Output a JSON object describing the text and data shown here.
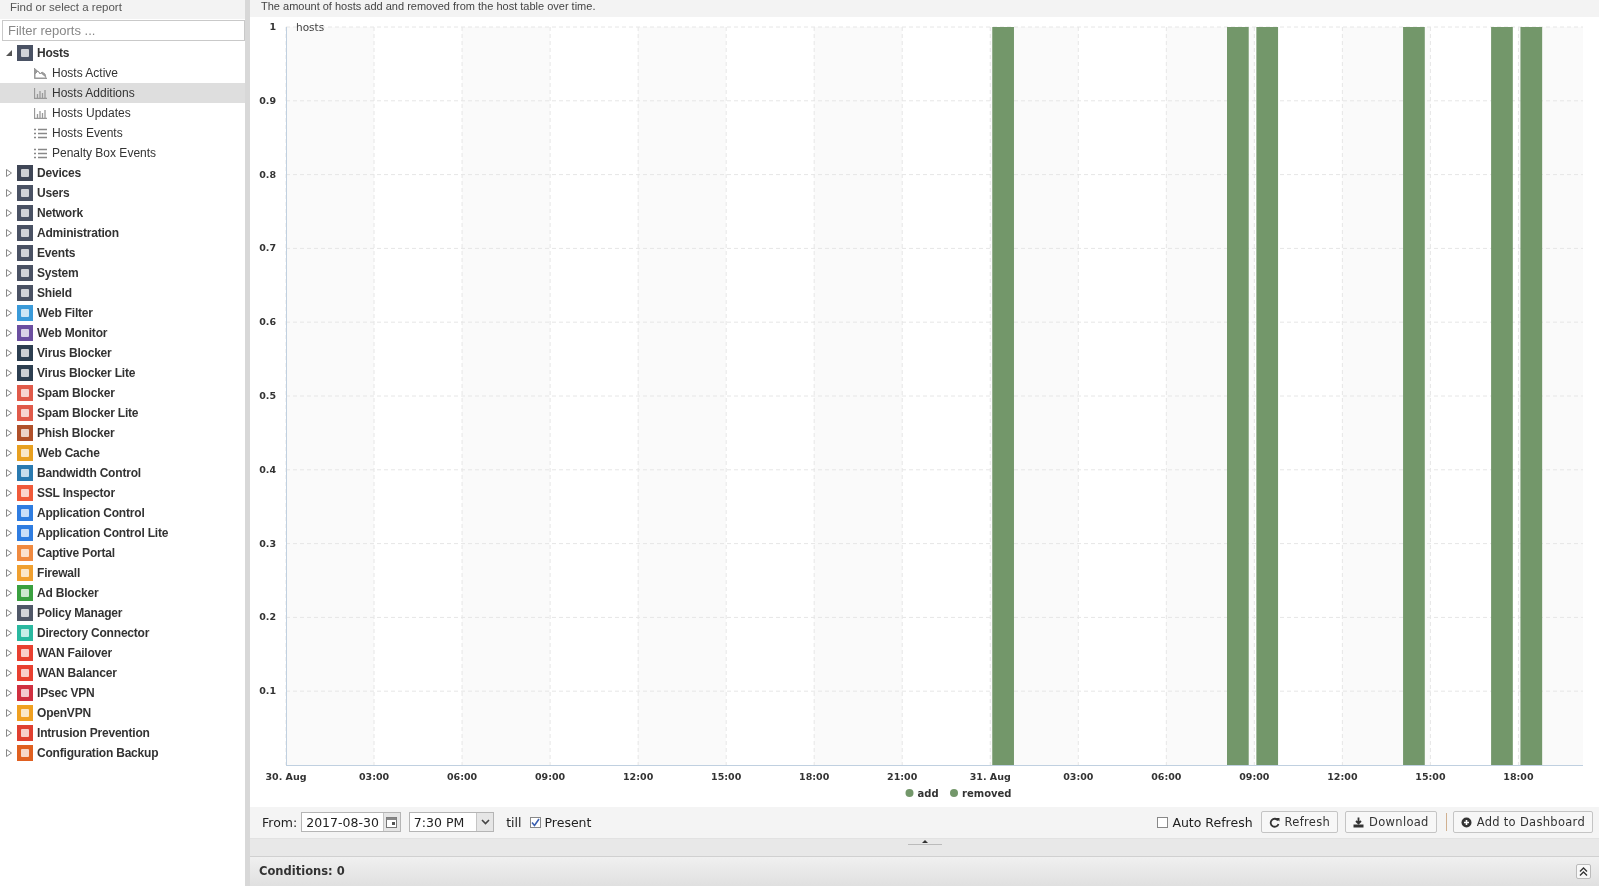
{
  "sidebar": {
    "header": "Find or select a report",
    "filter": {
      "placeholder": "Filter reports ..."
    },
    "items": [
      {
        "label": "Hosts",
        "color": "#4a5264",
        "expanded": true,
        "children": [
          {
            "label": "Hosts Active",
            "kind": "area",
            "selected": false
          },
          {
            "label": "Hosts Additions",
            "kind": "bar",
            "selected": true
          },
          {
            "label": "Hosts Updates",
            "kind": "bar",
            "selected": false
          },
          {
            "label": "Hosts Events",
            "kind": "list",
            "selected": false
          },
          {
            "label": "Penalty Box Events",
            "kind": "list",
            "selected": false
          }
        ]
      },
      {
        "label": "Devices",
        "color": "#3f4656",
        "expanded": false
      },
      {
        "label": "Users",
        "color": "#4a5264",
        "expanded": false
      },
      {
        "label": "Network",
        "color": "#4a5264",
        "expanded": false
      },
      {
        "label": "Administration",
        "color": "#4a5264",
        "expanded": false
      },
      {
        "label": "Events",
        "color": "#4a5264",
        "expanded": false
      },
      {
        "label": "System",
        "color": "#4a5264",
        "expanded": false
      },
      {
        "label": "Shield",
        "color": "#4a5264",
        "expanded": false
      },
      {
        "label": "Web Filter",
        "color": "#3a9ad9",
        "expanded": false
      },
      {
        "label": "Web Monitor",
        "color": "#6b4fa0",
        "expanded": false
      },
      {
        "label": "Virus Blocker",
        "color": "#2c3e50",
        "expanded": false
      },
      {
        "label": "Virus Blocker Lite",
        "color": "#2c3e50",
        "expanded": false
      },
      {
        "label": "Spam Blocker",
        "color": "#e05a4a",
        "expanded": false
      },
      {
        "label": "Spam Blocker Lite",
        "color": "#e05a4a",
        "expanded": false
      },
      {
        "label": "Phish Blocker",
        "color": "#b0502a",
        "expanded": false
      },
      {
        "label": "Web Cache",
        "color": "#e8a020",
        "expanded": false
      },
      {
        "label": "Bandwidth Control",
        "color": "#2a7ab0",
        "expanded": false
      },
      {
        "label": "SSL Inspector",
        "color": "#f05a3a",
        "expanded": false
      },
      {
        "label": "Application Control",
        "color": "#2f7de1",
        "expanded": false
      },
      {
        "label": "Application Control Lite",
        "color": "#2f7de1",
        "expanded": false
      },
      {
        "label": "Captive Portal",
        "color": "#f08a40",
        "expanded": false
      },
      {
        "label": "Firewall",
        "color": "#f0a030",
        "expanded": false
      },
      {
        "label": "Ad Blocker",
        "color": "#3aa040",
        "expanded": false
      },
      {
        "label": "Policy Manager",
        "color": "#505868",
        "expanded": false
      },
      {
        "label": "Directory Connector",
        "color": "#2ab8a0",
        "expanded": false
      },
      {
        "label": "WAN Failover",
        "color": "#e84030",
        "expanded": false
      },
      {
        "label": "WAN Balancer",
        "color": "#e84030",
        "expanded": false
      },
      {
        "label": "IPsec VPN",
        "color": "#d03040",
        "expanded": false
      },
      {
        "label": "OpenVPN",
        "color": "#f0a020",
        "expanded": false
      },
      {
        "label": "Intrusion Prevention",
        "color": "#e04030",
        "expanded": false
      },
      {
        "label": "Configuration Backup",
        "color": "#e06020",
        "expanded": false
      }
    ]
  },
  "report": {
    "description": "The amount of hosts add and removed from the host table over time.",
    "chart_data": {
      "type": "bar",
      "ylabel": "hosts",
      "x": [
        "2017-08-31T00:00",
        "2017-08-31T08:00",
        "2017-08-31T09:00",
        "2017-08-31T14:00",
        "2017-08-31T17:00",
        "2017-08-31T18:00"
      ],
      "series": [
        {
          "name": "add",
          "color": "#73976a",
          "values": [
            1,
            1,
            1,
            1,
            1,
            1
          ]
        },
        {
          "name": "removed",
          "color": "#73976a",
          "values": [
            0,
            0,
            0,
            0,
            0,
            0
          ]
        }
      ],
      "xlim": [
        "2017-08-30T00:00",
        "2017-08-31T20:12"
      ],
      "ylim": [
        0,
        1
      ],
      "grid": true,
      "yticks": [
        0.1,
        0.2,
        0.3,
        0.4,
        0.5,
        0.6,
        0.7,
        0.8,
        0.9,
        1
      ],
      "xticks": [
        {
          "value": "2017-08-30T00:00",
          "label": "30. Aug"
        },
        {
          "value": "2017-08-30T03:00",
          "label": "03:00"
        },
        {
          "value": "2017-08-30T06:00",
          "label": "06:00"
        },
        {
          "value": "2017-08-30T09:00",
          "label": "09:00"
        },
        {
          "value": "2017-08-30T12:00",
          "label": "12:00"
        },
        {
          "value": "2017-08-30T15:00",
          "label": "15:00"
        },
        {
          "value": "2017-08-30T18:00",
          "label": "18:00"
        },
        {
          "value": "2017-08-30T21:00",
          "label": "21:00"
        },
        {
          "value": "2017-08-31T00:00",
          "label": "31. Aug"
        },
        {
          "value": "2017-08-31T03:00",
          "label": "03:00"
        },
        {
          "value": "2017-08-31T06:00",
          "label": "06:00"
        },
        {
          "value": "2017-08-31T09:00",
          "label": "09:00"
        },
        {
          "value": "2017-08-31T12:00",
          "label": "12:00"
        },
        {
          "value": "2017-08-31T15:00",
          "label": "15:00"
        },
        {
          "value": "2017-08-31T18:00",
          "label": "18:00"
        }
      ]
    }
  },
  "toolbar": {
    "from_label": "From:",
    "date": "2017-08-30",
    "time": "7:30 PM",
    "till_label": "till",
    "present": {
      "label": "Present",
      "checked": true
    },
    "auto_refresh": {
      "label": "Auto Refresh",
      "checked": false
    },
    "buttons": [
      "Refresh",
      "Download",
      "Add to Dashboard"
    ]
  },
  "conditions": {
    "label": "Conditions: 0"
  }
}
